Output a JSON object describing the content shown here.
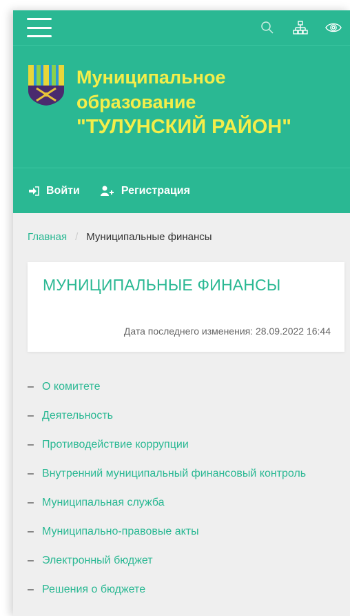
{
  "topbar": {
    "menu_icon": "hamburger-icon",
    "icons": [
      "search-icon",
      "sitemap-icon",
      "eye-icon"
    ]
  },
  "header": {
    "title_line1": "Муниципальное",
    "title_line2": "образование",
    "title_line3": "\"ТУЛУНСКИЙ РАЙОН\"",
    "emblem": "coat-of-arms-emblem"
  },
  "auth": {
    "login": "Войти",
    "register": "Регистрация"
  },
  "breadcrumb": {
    "home": "Главная",
    "separator": "/",
    "current": "Муниципальные финансы"
  },
  "page": {
    "title": "МУНИЦИПАЛЬНЫЕ ФИНАНСЫ",
    "last_modified": "Дата последнего изменения: 28.09.2022 16:44"
  },
  "menu": {
    "dash": "–",
    "items": [
      "О комитете",
      "Деятельность",
      "Противодействие коррупции",
      "Внутренний муниципальный финансовый контроль",
      "Муниципальная служба",
      "Муниципально-правовые акты",
      "Электронный бюджет",
      "Решения о бюджете"
    ]
  },
  "colors": {
    "accent": "#2ab893",
    "title_yellow": "#f4ee4a",
    "background": "#efefef"
  }
}
